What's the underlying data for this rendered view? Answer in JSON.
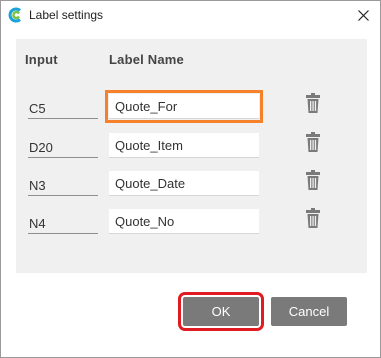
{
  "window": {
    "title": "Label settings"
  },
  "table": {
    "header_input": "Input",
    "header_label_name": "Label Name",
    "rows": [
      {
        "input": "C5",
        "label_name": "Quote_For",
        "focused": true
      },
      {
        "input": "D20",
        "label_name": "Quote_Item",
        "focused": false
      },
      {
        "input": "N3",
        "label_name": "Quote_Date",
        "focused": false
      },
      {
        "input": "N4",
        "label_name": "Quote_No",
        "focused": false
      }
    ]
  },
  "buttons": {
    "ok_label": "OK",
    "cancel_label": "Cancel"
  },
  "colors": {
    "button_bg": "#7a7a7a",
    "focus_outline": "#f5822a",
    "ok_highlight": "#e01b22",
    "panel_bg": "#f0f0f0"
  },
  "icons": {
    "app": "app-logo-icon",
    "close": "close-icon",
    "delete": "trash-icon"
  }
}
